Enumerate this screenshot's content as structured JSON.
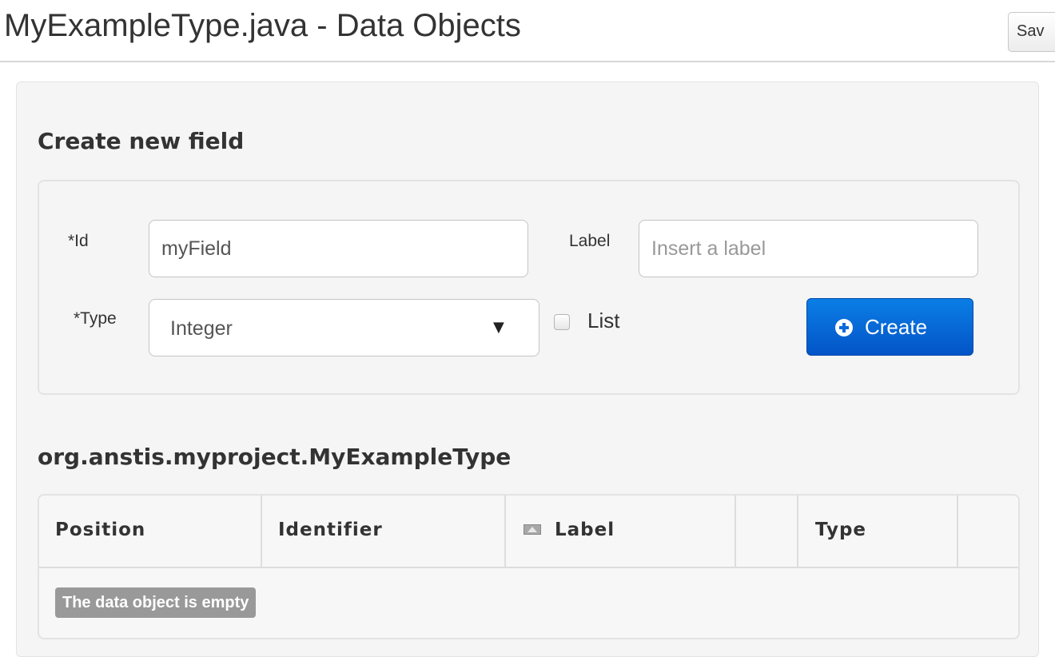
{
  "header": {
    "title": "MyExampleType.java - Data Objects",
    "save_label": "Sav"
  },
  "create_section": {
    "title": "Create new field",
    "id_label": "*Id",
    "id_value": "myField",
    "label_label": "Label",
    "label_placeholder": "Insert a label",
    "type_label": "*Type",
    "type_selected": "Integer",
    "list_label": "List",
    "list_checked": false,
    "create_label": "Create",
    "create_icon": "plus-circle-icon"
  },
  "object_section": {
    "title": "org.anstis.myproject.MyExampleType",
    "columns": [
      "Position",
      "Identifier",
      "Label",
      "",
      "Type",
      ""
    ],
    "sorted_column": "Label",
    "empty_message": "The data object is empty"
  },
  "colors": {
    "primary_button": "#0a6bd8",
    "badge": "#999999",
    "panel_background": "#f5f5f5"
  }
}
